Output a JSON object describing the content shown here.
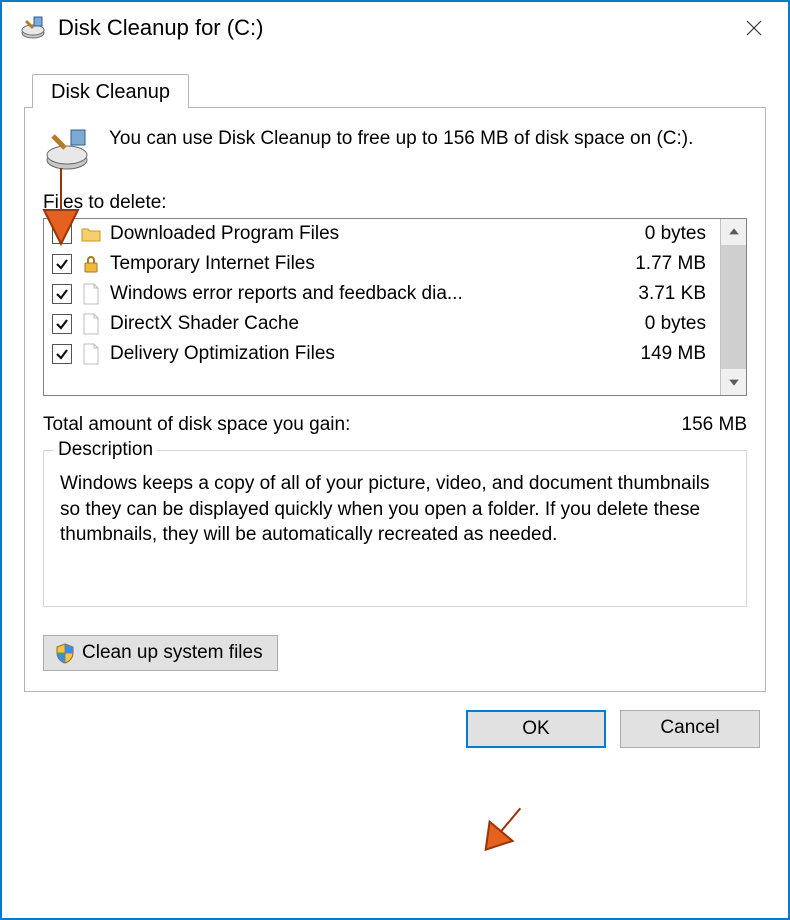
{
  "title": "Disk Cleanup for  (C:)",
  "tab_label": "Disk Cleanup",
  "intro_text": "You can use Disk Cleanup to free up to 156 MB of disk space on  (C:).",
  "files_label": "Files to delete:",
  "files": [
    {
      "checked": true,
      "icon": "folder",
      "name": "Downloaded Program Files",
      "size": "0 bytes"
    },
    {
      "checked": true,
      "icon": "lock",
      "name": "Temporary Internet Files",
      "size": "1.77 MB"
    },
    {
      "checked": true,
      "icon": "file",
      "name": "Windows error reports and feedback dia...",
      "size": "3.71 KB"
    },
    {
      "checked": true,
      "icon": "file",
      "name": "DirectX Shader Cache",
      "size": "0 bytes"
    },
    {
      "checked": true,
      "icon": "file",
      "name": "Delivery Optimization Files",
      "size": "149 MB"
    }
  ],
  "total_label": "Total amount of disk space you gain:",
  "total_value": "156 MB",
  "description_legend": "Description",
  "description_text": "Windows keeps a copy of all of your picture, video, and document thumbnails so they can be displayed quickly when you open a folder. If you delete these thumbnails, they will be automatically recreated as needed.",
  "cleanup_button": "Clean up system files",
  "ok_label": "OK",
  "cancel_label": "Cancel"
}
